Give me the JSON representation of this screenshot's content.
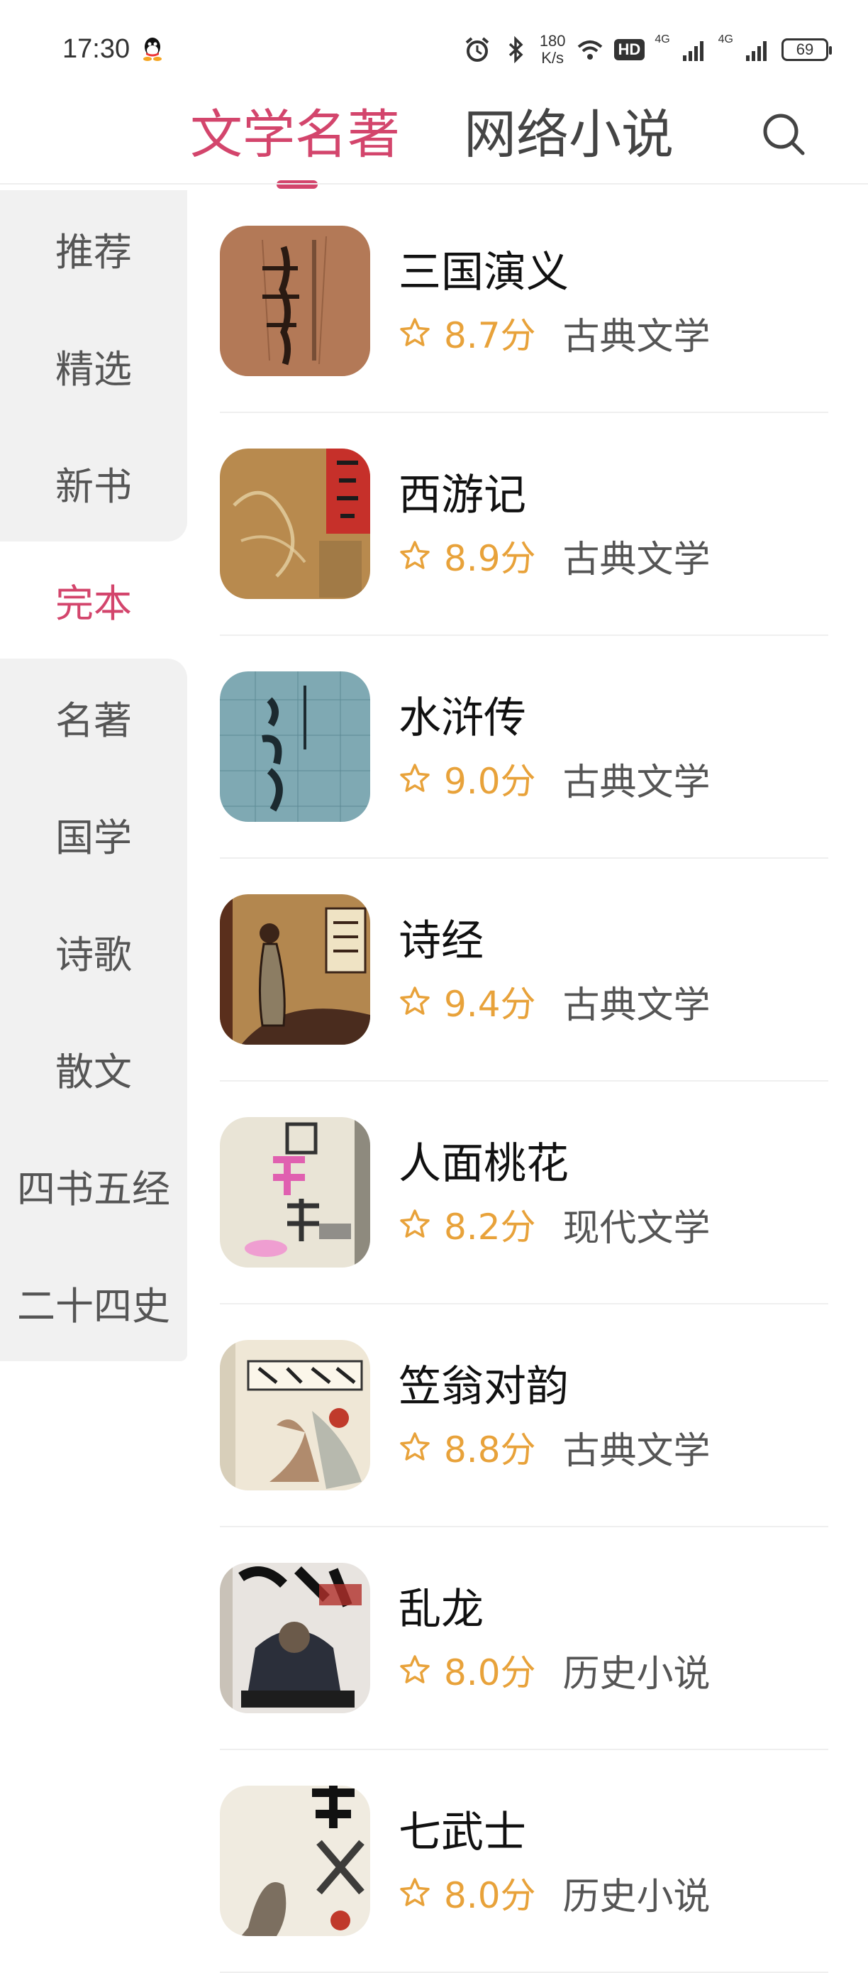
{
  "status_bar": {
    "time": "17:30",
    "net_speed_value": "180",
    "net_speed_unit": "K/s",
    "hd_label": "HD",
    "sim1_label": "4G",
    "sim2_label": "4G",
    "battery": "69"
  },
  "tabs": [
    {
      "label": "文学名著",
      "active": true
    },
    {
      "label": "网络小说",
      "active": false
    }
  ],
  "sidebar": {
    "items": [
      {
        "label": "推荐"
      },
      {
        "label": "精选"
      },
      {
        "label": "新书"
      },
      {
        "label": "完本",
        "active": true
      },
      {
        "label": "名著"
      },
      {
        "label": "国学"
      },
      {
        "label": "诗歌"
      },
      {
        "label": "散文"
      },
      {
        "label": "四书五经"
      },
      {
        "label": "二十四史"
      }
    ]
  },
  "books": [
    {
      "title": "三国演义",
      "score": "8.7分",
      "genre": "古典文学",
      "cover_color": "#b9805e"
    },
    {
      "title": "西游记",
      "score": "8.9分",
      "genre": "古典文学",
      "cover_color": "#b88a4e"
    },
    {
      "title": "水浒传",
      "score": "9.0分",
      "genre": "古典文学",
      "cover_color": "#7fa9b3"
    },
    {
      "title": "诗经",
      "score": "9.4分",
      "genre": "古典文学",
      "cover_color": "#b3874f"
    },
    {
      "title": "人面桃花",
      "score": "8.2分",
      "genre": "现代文学",
      "cover_color": "#e9e4d6"
    },
    {
      "title": "笠翁对韵",
      "score": "8.8分",
      "genre": "古典文学",
      "cover_color": "#efe7d6"
    },
    {
      "title": "乱龙",
      "score": "8.0分",
      "genre": "历史小说",
      "cover_color": "#e8e4e0"
    },
    {
      "title": "七武士",
      "score": "8.0分",
      "genre": "历史小说",
      "cover_color": "#f0ebe0"
    }
  ],
  "colors": {
    "accent": "#d3456c",
    "score": "#e8a23a",
    "sidebar_bg": "#f1f1f1"
  },
  "icons": {
    "search": "search-icon",
    "star": "star-outline-icon",
    "alarm": "alarm-icon",
    "bluetooth": "bluetooth-icon",
    "wifi": "wifi-icon",
    "signal": "signal-icon",
    "battery": "battery-icon",
    "qq": "qq-icon"
  }
}
